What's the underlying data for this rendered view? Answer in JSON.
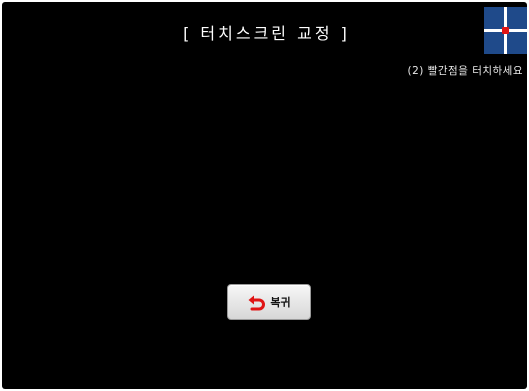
{
  "header": {
    "title": "[ 터치스크린 교정 ]"
  },
  "calibration": {
    "instruction": "(2) 빨간점을 터치하세요",
    "target_color": "#e01414",
    "target_background": "#1f4a8a"
  },
  "back_button": {
    "label": "복귀",
    "icon": "undo-arrow-icon",
    "icon_color": "#e01414"
  }
}
